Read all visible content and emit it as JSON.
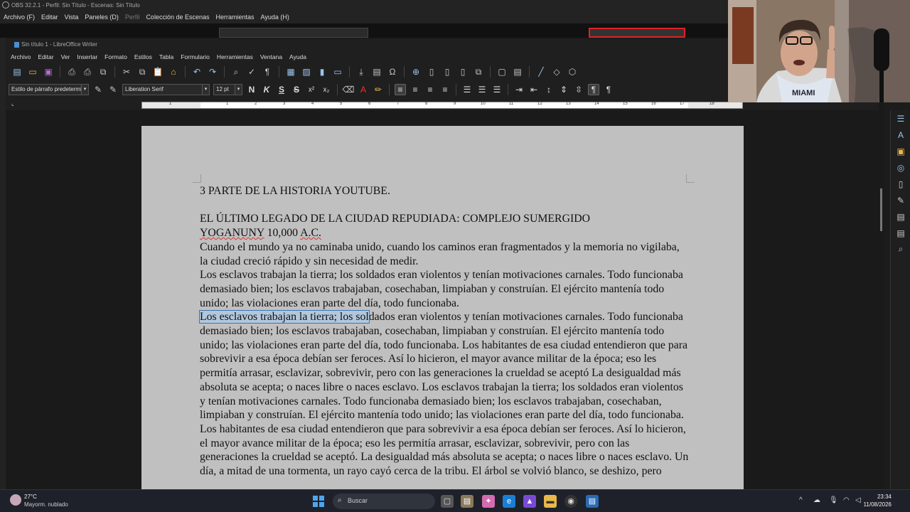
{
  "obs": {
    "title": "OBS 32.2.1 - Perfil: Sin Título - Escenas: Sin Título",
    "menu": [
      "Archivo (F)",
      "Editar",
      "Vista",
      "Paneles (D)",
      "Perfil",
      "Colección de Escenas",
      "Herramientas",
      "Ayuda (H)"
    ]
  },
  "writer": {
    "window_title": "Sin título 1 - LibreOffice Writer",
    "menu": [
      "Archivo",
      "Editar",
      "Ver",
      "Insertar",
      "Formato",
      "Estilos",
      "Tabla",
      "Formulario",
      "Herramientas",
      "Ventana",
      "Ayuda"
    ],
    "paragraph_style": "Estilo de párrafo predetermi",
    "font_name": "Liberation Serif",
    "font_size": "12 pt",
    "format_buttons": {
      "bold": "N",
      "italic": "K",
      "underline": "S",
      "strike": "S",
      "superscript": "x²",
      "subscript": "x₂"
    },
    "ruler_numbers": [
      "1",
      "1",
      "2",
      "3",
      "4",
      "5",
      "6",
      "7",
      "8",
      "9",
      "10",
      "11",
      "12",
      "13",
      "14",
      "15",
      "16",
      "17",
      "18"
    ]
  },
  "document": {
    "heading1": "3 PARTE DE LA HISTORIA YOUTUBE.",
    "heading2_line1": "EL ÚLTIMO LEGADO DE LA CIUDAD REPUDIADA: COMPLEJO SUMERGIDO",
    "heading2_line2_a": "YOGANUNY",
    "heading2_line2_b": " 10,000 ",
    "heading2_line2_c": "A.C.",
    "para1": "Cuando el mundo ya no caminaba unido, cuando los caminos eran fragmentados y la memoria no vigilaba, la ciudad creció rápido y sin necesidad de medir.",
    "para2": "Los esclavos trabajan la tierra; los soldados eran violentos y tenían motivaciones carnales. Todo funcionaba demasiado bien; los esclavos trabajaban, cosechaban, limpiaban y construían. El ejército mantenía todo unido; las violaciones eran parte del día, todo funcionaba.",
    "para3_selected": " Los esclavos trabajan la tierra; los sol",
    "para3_rest": "dados eran violentos y tenían motivaciones carnales. Todo funcionaba demasiado bien; los esclavos trabajaban, cosechaban, limpiaban y construían. El ejército mantenía todo unido; las violaciones eran parte del día, todo funcionaba. Los habitantes de esa ciudad entendieron que para sobrevivir a esa época debían ser feroces. Así lo hicieron, el mayor avance militar de la época; eso les permitía arrasar, esclavizar, sobrevivir, pero con las generaciones la crueldad se aceptó La desigualdad más absoluta se acepta; o naces libre o naces esclavo. Los esclavos trabajan la tierra; los soldados eran violentos y tenían motivaciones carnales. Todo funcionaba demasiado bien; los esclavos trabajaban, cosechaban, limpiaban y construían. El ejército mantenía todo unido; las violaciones eran parte del día, todo funcionaba. Los habitantes de esa ciudad entendieron que para sobrevivir a esa época debían ser feroces. Así lo hicieron, el mayor avance militar de la época; eso les permitía arrasar, esclavizar, sobrevivir, pero con las generaciones la crueldad se aceptó. La desigualdad más absoluta se acepta; o naces libre o naces esclavo. Un día, a mitad de una tormenta, un rayo cayó cerca de la tribu. El árbol se volvió blanco, se deshizo, pero"
  },
  "taskbar": {
    "weather_temp": "27°C",
    "weather_desc": "Mayorm. nublado",
    "search_placeholder": "Buscar",
    "time": "23:34",
    "date": "11/08/2026"
  }
}
